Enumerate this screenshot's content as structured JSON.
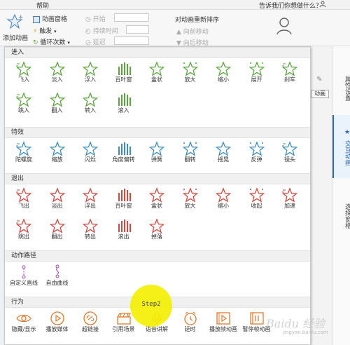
{
  "menubar": {
    "help": "帮助",
    "tell_me": "告诉我们你想做什么？"
  },
  "ribbon": {
    "add_animation": "添加动画",
    "animation_pane": "动画窗格",
    "trigger": "触发",
    "repeat": "循环次数",
    "start": "开始",
    "duration": "持续时间",
    "delay": "延迟",
    "reorder": "对动画重新排序",
    "move_earlier": "向前移动",
    "move_later": "向后移动"
  },
  "right_pane": {
    "tabs": [
      "属性设置",
      "交互动画",
      "选择窗格"
    ]
  },
  "bg": {
    "anim_label": "动画"
  },
  "sections": {
    "enter": {
      "title": "进入",
      "items": [
        "飞入",
        "淡入",
        "浮入",
        "百叶窗",
        "盒状",
        "放大",
        "缩小",
        "展开",
        "刹车",
        "跳入",
        "翻入",
        "转入",
        "滚入"
      ]
    },
    "emphasis": {
      "title": "特效",
      "items": [
        "陀螺旋",
        "缩放",
        "闪烁",
        "角度偏转",
        "弹簧",
        "翻转",
        "摇晃",
        "反弹",
        "镜头"
      ]
    },
    "exit": {
      "title": "退出",
      "items": [
        "飞出",
        "淡出",
        "浮出",
        "百叶窗",
        "盒状",
        "放大",
        "缩小",
        "收起",
        "加速",
        "跳出",
        "翻出",
        "转出",
        "滚出",
        "掉落"
      ]
    },
    "path": {
      "title": "动作路径",
      "items": [
        "自定义直线",
        "自由曲线"
      ]
    },
    "action": {
      "title": "行为",
      "items": [
        "隐藏/显示",
        "播放媒体",
        "超链接",
        "引用场景",
        "语音讲解",
        "延时",
        "播放帧动画",
        "暂停帧动画"
      ]
    }
  },
  "callout": {
    "step": "Step2"
  },
  "watermark": {
    "brand": "Baidu 经验",
    "url": "jingyan.baidu.com"
  },
  "colors": {
    "enter": "#5aa83c",
    "emphasis": "#3b8ec5",
    "exit": "#d9463d",
    "path": "#a545b3",
    "action": "#e57a2e",
    "active_tab": "#2b6cb5"
  }
}
